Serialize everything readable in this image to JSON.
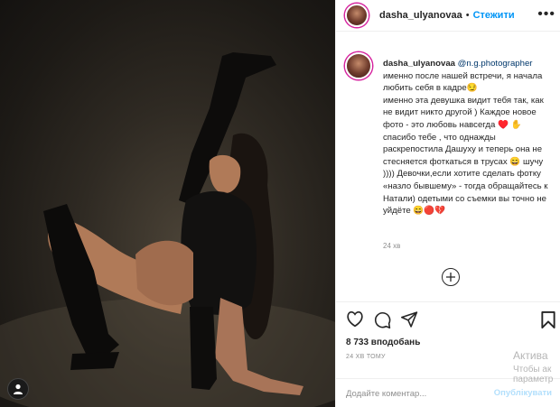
{
  "post": {
    "author": "dasha_ulyanovaa",
    "dot": "•",
    "follow_label": "Стежити",
    "more_label": "•••"
  },
  "caption": {
    "author": "dasha_ulyanovaa",
    "mention": "@n.g.photographer",
    "text": "именно после нашей встречи, я начала любить себя в кадре😏\nименно эта девушка видит тебя так, как не видит никто другой ) Каждое новое фото - это любовь навсегда ♥️ ✋ спасибо тебе , что однажды раскрепостила Дашуху и теперь она не стесняется фоткаться в трусах 😄 шучу )))) Девочки,если хотите сделать фотку «назло бывшему» - тогда обращайтесь к Натали) одетыми со съемки вы точно не уйдёте 😄🔴💔",
    "time": "24 хв"
  },
  "actions": {
    "likes": "8 733 вподобань",
    "time": "24 ХВ ТОМУ"
  },
  "comment_input": {
    "placeholder": "Додайте коментар...",
    "publish_label": "Опублікувати"
  },
  "watermark": {
    "line1": "Актива",
    "line2": "Чтобы ак параметр"
  },
  "icons": [
    "heart-icon",
    "comment-icon",
    "share-icon",
    "bookmark-icon",
    "plus-circle-icon",
    "user-tag-icon",
    "more-icon"
  ]
}
